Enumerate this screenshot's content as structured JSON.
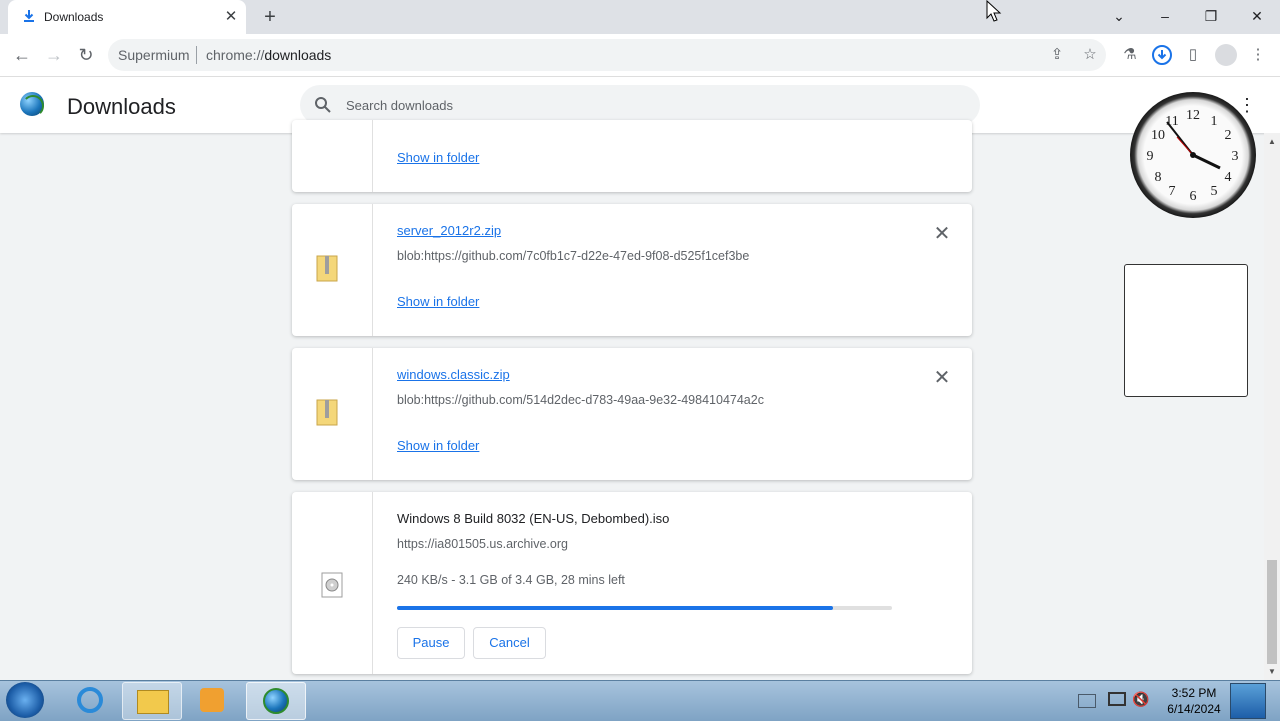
{
  "browser": {
    "tab_title": "Downloads",
    "omnibox_brand": "Supermium",
    "omnibox_scheme": "chrome://",
    "omnibox_host": "downloads"
  },
  "page": {
    "title": "Downloads",
    "search_placeholder": "Search downloads"
  },
  "downloads": [
    {
      "show_in_folder": "Show in folder"
    },
    {
      "name": "server_2012r2.zip",
      "url": "blob:https://github.com/7c0fb1c7-d22e-47ed-9f08-d525f1cef3be",
      "show_in_folder": "Show in folder"
    },
    {
      "name": "windows.classic.zip",
      "url": "blob:https://github.com/514d2dec-d783-49aa-9e32-498410474a2c",
      "show_in_folder": "Show in folder"
    },
    {
      "name": "Windows 8 Build 8032 (EN-US, Debombed).iso",
      "url": "https://ia801505.us.archive.org",
      "status": "240 KB/s - 3.1 GB of 3.4 GB, 28 mins left",
      "progress_fraction": 0.88,
      "pause_label": "Pause",
      "cancel_label": "Cancel"
    }
  ],
  "taskbar": {
    "time": "3:52 PM",
    "date": "6/14/2024"
  },
  "colors": {
    "accent": "#1a73e8"
  }
}
